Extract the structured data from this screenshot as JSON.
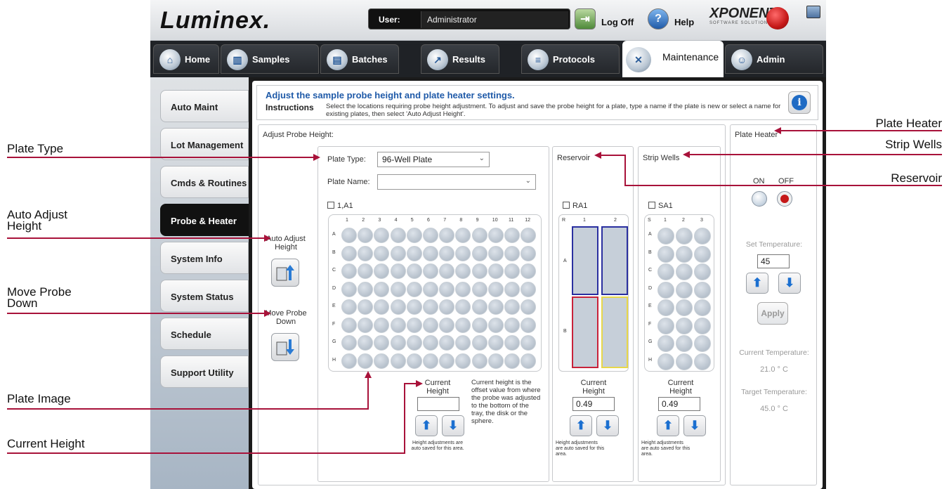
{
  "app": {
    "logo": "Luminex.",
    "user_label": "User:",
    "user_value": "Administrator",
    "logoff_label": "Log Off",
    "help_label": "Help",
    "brand": "XPONENT.",
    "brand_sub": "SOFTWARE SOLUTIONS"
  },
  "tabs": [
    {
      "label": "Home"
    },
    {
      "label": "Samples"
    },
    {
      "label": "Batches"
    },
    {
      "label": "Results"
    },
    {
      "label": "Protocols"
    },
    {
      "label": "Maintenance"
    },
    {
      "label": "Admin"
    }
  ],
  "nav": [
    {
      "label": "Auto Maint"
    },
    {
      "label": "Lot Management"
    },
    {
      "label": "Cmds & Routines"
    },
    {
      "label": "Probe & Heater"
    },
    {
      "label": "System Info"
    },
    {
      "label": "System Status"
    },
    {
      "label": "Schedule"
    },
    {
      "label": "Support Utility"
    }
  ],
  "instructions": {
    "title": "Adjust the sample probe height and plate heater settings.",
    "label": "Instructions",
    "text": "Select the locations requiring probe height adjustment. To adjust and save the probe height for a plate, type a name if the plate is new or select a name for existing plates, then select 'Auto Adjust Height'."
  },
  "probe": {
    "section_title": "Adjust Probe Height:",
    "plate_type_label": "Plate Type:",
    "plate_type_value": "96-Well Plate",
    "plate_name_label": "Plate Name:",
    "plate_name_value": "",
    "a1_checkbox": "1,A1",
    "auto_adjust_label": "Auto Adjust Height",
    "move_down_label": "Move Probe Down",
    "plate_cols": [
      "1",
      "2",
      "3",
      "4",
      "5",
      "6",
      "7",
      "8",
      "9",
      "10",
      "11",
      "12"
    ],
    "plate_rows": [
      "A",
      "B",
      "C",
      "D",
      "E",
      "F",
      "G",
      "H"
    ],
    "current_height_label": "Current Height",
    "current_height_value": "",
    "current_height_note": "Current height is the offset value from where the probe was adjusted to the bottom of the tray, the disk or the sphere.",
    "auto_saved_note": "Height adjustments are auto saved for this area."
  },
  "reservoir": {
    "title": "Reservoir",
    "checkbox": "RA1",
    "corner": "R",
    "cols": [
      "1",
      "2"
    ],
    "rows": [
      "A",
      "B"
    ],
    "current_height_label": "Current Height",
    "current_height_value": "0.49",
    "auto_saved_note": "Height adjustments are auto saved for this area."
  },
  "strip": {
    "title": "Strip Wells",
    "checkbox": "SA1",
    "corner": "S",
    "cols": [
      "1",
      "2",
      "3"
    ],
    "rows": [
      "A",
      "B",
      "C",
      "D",
      "E",
      "F",
      "G",
      "H"
    ],
    "current_height_label": "Current Height",
    "current_height_value": "0.49",
    "auto_saved_note": "Height adjustments are auto saved for this area."
  },
  "heater": {
    "title": "Plate Heater",
    "on_label": "ON",
    "off_label": "OFF",
    "state": "OFF",
    "set_temp_label": "Set Temperature:",
    "set_temp_value": "45",
    "apply_label": "Apply",
    "current_temp_label": "Current Temperature:",
    "current_temp_value": "21.0 ° C",
    "target_temp_label": "Target Temperature:",
    "target_temp_value": "45.0 ° C"
  },
  "annotations": {
    "plate_type": "Plate Type",
    "auto_adjust": "Auto Adjust Height",
    "move_probe": "Move Probe Down",
    "plate_image": "Plate Image",
    "current_height": "Current Height",
    "plate_heater": "Plate Heater",
    "strip_wells": "Strip Wells",
    "reservoir": "Reservoir"
  },
  "colors": {
    "annotation_arrow": "#a8123a",
    "accent_blue": "#1f5aa8",
    "reservoir_blue": "#2a2fa0",
    "reservoir_red": "#c8223a",
    "reservoir_yellow": "#e8d84a",
    "heater_off": "#c51818"
  },
  "icons": [
    "home-icon",
    "samples-icon",
    "batches-icon",
    "results-icon",
    "protocols-icon",
    "maintenance-icon",
    "admin-icon",
    "logoff-icon",
    "help-icon",
    "info-icon",
    "arrow-up-icon",
    "arrow-down-icon"
  ]
}
